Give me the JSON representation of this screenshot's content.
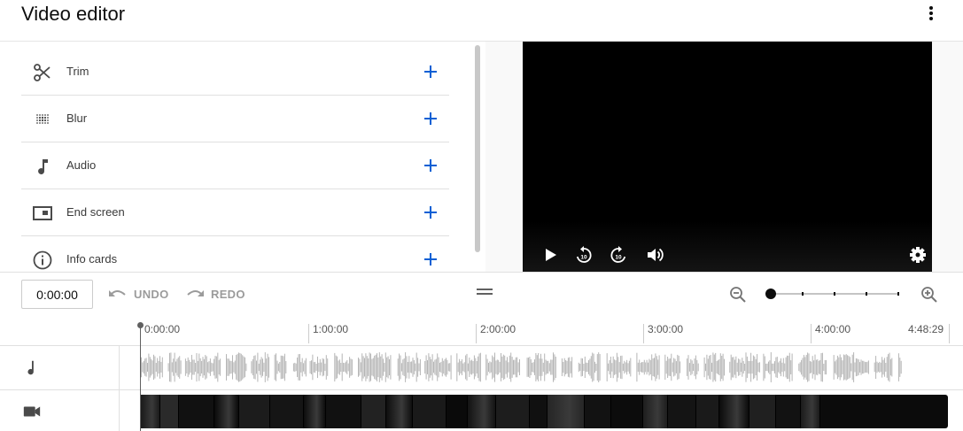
{
  "header": {
    "title": "Video editor",
    "menu_icon": "more-vert-icon"
  },
  "tools": [
    {
      "label": "Trim",
      "icon": "scissors-icon"
    },
    {
      "label": "Blur",
      "icon": "blur-icon"
    },
    {
      "label": "Audio",
      "icon": "music-note-icon"
    },
    {
      "label": "End screen",
      "icon": "end-screen-icon"
    },
    {
      "label": "Info cards",
      "icon": "info-icon"
    }
  ],
  "player": {
    "controls": [
      "play-icon",
      "rewind-10-icon",
      "forward-10-icon",
      "volume-icon",
      "settings-icon"
    ]
  },
  "timeline": {
    "current_time": "0:00:00",
    "undo_label": "UNDO",
    "redo_label": "REDO",
    "ruler": [
      "0:00:00",
      "1:00:00",
      "2:00:00",
      "3:00:00",
      "4:00:00",
      "4:48:29"
    ]
  },
  "colors": {
    "accent": "#065fd4",
    "text": "#0d0d0d",
    "muted": "#9b9b9b",
    "waveform": "#b5b5b5"
  }
}
